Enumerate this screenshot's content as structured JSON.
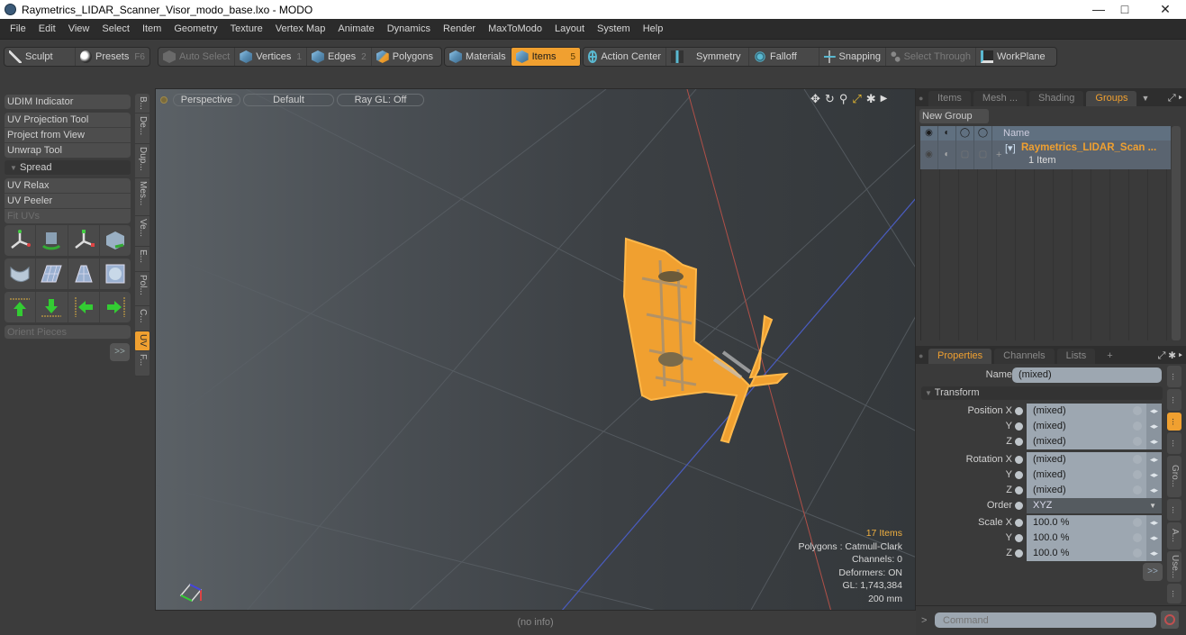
{
  "window": {
    "title": "Raymetrics_LIDAR_Scanner_Visor_modo_base.lxo - MODO",
    "controls": {
      "minimize": "—",
      "maximize": "□",
      "close": "✕"
    }
  },
  "menubar": [
    "File",
    "Edit",
    "View",
    "Select",
    "Item",
    "Geometry",
    "Texture",
    "Vertex Map",
    "Animate",
    "Dynamics",
    "Render",
    "MaxToModo",
    "Layout",
    "System",
    "Help"
  ],
  "toolbar": {
    "sculpt": "Sculpt",
    "presets": "Presets",
    "presets_key": "F6",
    "auto_select": "Auto Select",
    "vertices": "Vertices",
    "vertices_key": "1",
    "edges": "Edges",
    "edges_key": "2",
    "polygons": "Polygons",
    "materials": "Materials",
    "items": "Items",
    "items_key": "5",
    "action_center": "Action Center",
    "symmetry": "Symmetry",
    "falloff": "Falloff",
    "snapping": "Snapping",
    "select_through": "Select Through",
    "workplane": "WorkPlane"
  },
  "left_panel": {
    "udim": "UDIM Indicator",
    "uv_projection": "UV Projection Tool",
    "project_from_view": "Project from View",
    "unwrap_tool": "Unwrap Tool",
    "spread": "Spread",
    "uv_relax": "UV Relax",
    "uv_peeler": "UV Peeler",
    "fit_uvs": "Fit UVs",
    "orient_pieces": "Orient Pieces",
    "more": ">>",
    "vertical_tabs": [
      "B...",
      "De...",
      "Dup...",
      "Mes...",
      "Ve...",
      "E...",
      "Pol...",
      "C...",
      "UV",
      "F..."
    ],
    "active_tab": "UV"
  },
  "viewport": {
    "view_mode": "Perspective",
    "shading": "Default",
    "raygl": "Ray GL: Off",
    "info": {
      "items": "17 Items",
      "polygons": "Polygons : Catmull-Clark",
      "channels": "Channels: 0",
      "deformers": "Deformers: ON",
      "gl": "GL: 1,743,384",
      "scale": "200 mm"
    },
    "status": "(no info)",
    "colors": {
      "selection": "#f0a030",
      "x_axis": "#c0504a",
      "z_axis": "#4a5cc0"
    }
  },
  "groups_panel": {
    "tabs": [
      "Items",
      "Mesh ...",
      "Shading",
      "Groups"
    ],
    "active_tab": "Groups",
    "new_group": "New Group",
    "column_name": "Name",
    "row": {
      "name": "Raymetrics_LIDAR_Scan ...",
      "count": "1 Item"
    }
  },
  "properties_panel": {
    "tabs": [
      "Properties",
      "Channels",
      "Lists",
      "+"
    ],
    "active_tab": "Properties",
    "name_label": "Name",
    "name_value": "(mixed)",
    "section": "Transform",
    "rows": [
      {
        "label": "Position X",
        "value": "(mixed)"
      },
      {
        "label": "Y",
        "value": "(mixed)"
      },
      {
        "label": "Z",
        "value": "(mixed)"
      },
      {
        "label": "Rotation X",
        "value": "(mixed)"
      },
      {
        "label": "Y",
        "value": "(mixed)"
      },
      {
        "label": "Z",
        "value": "(mixed)"
      },
      {
        "label": "Order",
        "value": "XYZ"
      },
      {
        "label": "Scale X",
        "value": "100.0 %"
      },
      {
        "label": "Y",
        "value": "100.0 %"
      },
      {
        "label": "Z",
        "value": "100.0 %"
      }
    ],
    "more": ">>",
    "side_tabs": [
      "...",
      "...",
      "...",
      "...",
      "Gro...",
      "...",
      "A...",
      "Use...",
      "..."
    ]
  },
  "command": {
    "prompt": ">",
    "placeholder": "Command"
  }
}
